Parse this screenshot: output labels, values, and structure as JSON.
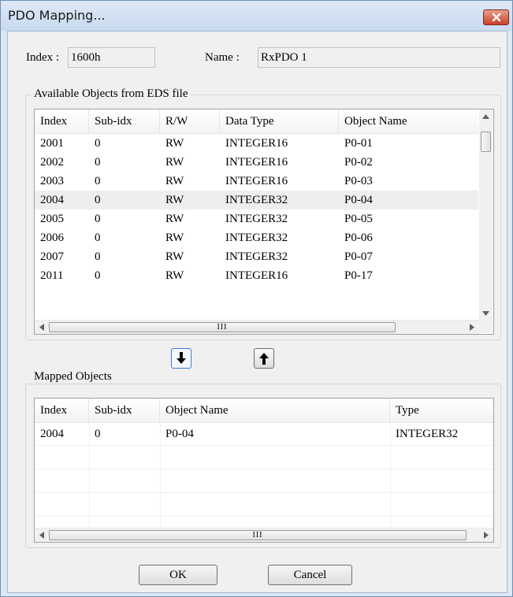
{
  "window": {
    "title": "PDO Mapping...",
    "close_icon": "close-x-icon",
    "colors": {
      "title_bg": "#d3e2f3",
      "close_bg": "#c9402a",
      "client_bg": "#f0f0f0",
      "move_down_border": "#3a7bd5"
    }
  },
  "fields": {
    "index_label": "Index :",
    "index_value": "1600h",
    "name_label": "Name :",
    "name_value": "RxPDO 1"
  },
  "available": {
    "legend": "Available Objects from EDS file",
    "columns": [
      "Index",
      "Sub-idx",
      "R/W",
      "Data Type",
      "Object Name"
    ],
    "rows": [
      [
        "2001",
        "0",
        "RW",
        "INTEGER16",
        "P0-01"
      ],
      [
        "2002",
        "0",
        "RW",
        "INTEGER16",
        "P0-02"
      ],
      [
        "2003",
        "0",
        "RW",
        "INTEGER16",
        "P0-03"
      ],
      [
        "2004",
        "0",
        "RW",
        "INTEGER32",
        "P0-04"
      ],
      [
        "2005",
        "0",
        "RW",
        "INTEGER32",
        "P0-05"
      ],
      [
        "2006",
        "0",
        "RW",
        "INTEGER32",
        "P0-06"
      ],
      [
        "2007",
        "0",
        "RW",
        "INTEGER32",
        "P0-07"
      ],
      [
        "2011",
        "0",
        "RW",
        "INTEGER16",
        "P0-17"
      ]
    ],
    "selected_index": 3
  },
  "controls": {
    "move_down_icon": "arrow-down-icon",
    "move_up_icon": "arrow-up-icon",
    "scroll_grip": "III"
  },
  "mapped": {
    "legend": "Mapped Objects",
    "columns": [
      "Index",
      "Sub-idx",
      "Object Name",
      "Type"
    ],
    "rows": [
      [
        "2004",
        "0",
        "P0-04",
        "INTEGER32"
      ]
    ]
  },
  "buttons": {
    "ok": "OK",
    "cancel": "Cancel"
  }
}
